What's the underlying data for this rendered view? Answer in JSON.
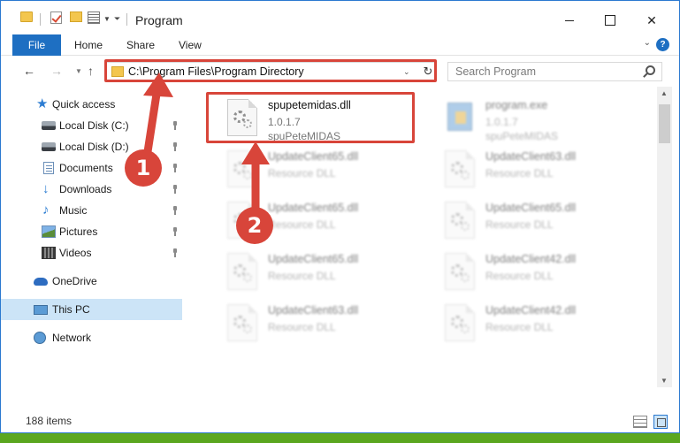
{
  "window": {
    "title": "Program"
  },
  "ribbon": {
    "tabs": [
      "File",
      "Home",
      "Share",
      "View"
    ],
    "help": "?"
  },
  "nav": {
    "address": "C:\\Program Files\\Program Directory",
    "search_placeholder": "Search Program"
  },
  "sidebar": {
    "items": [
      {
        "label": "Quick access",
        "icon": "star-icon"
      },
      {
        "label": "Local Disk (C:)",
        "icon": "drive-icon"
      },
      {
        "label": "Local Disk (D:)",
        "icon": "drive-icon"
      },
      {
        "label": "Documents",
        "icon": "documents-icon"
      },
      {
        "label": "Downloads",
        "icon": "download-icon"
      },
      {
        "label": "Music",
        "icon": "music-icon"
      },
      {
        "label": "Pictures",
        "icon": "pictures-icon"
      },
      {
        "label": "Videos",
        "icon": "videos-icon"
      },
      {
        "label": "OneDrive",
        "icon": "cloud-icon"
      },
      {
        "label": "This PC",
        "icon": "pc-icon"
      },
      {
        "label": "Network",
        "icon": "network-icon"
      }
    ]
  },
  "files": [
    {
      "name": "spupetemidas.dll",
      "version": "1.0.1.7",
      "company": "spuPeteMIDAS"
    },
    {
      "name": "program.exe",
      "version": "1.0.1.7",
      "company": "spuPeteMIDAS"
    },
    {
      "name": "UpdateClient65.dll",
      "type": "Resource DLL"
    },
    {
      "name": "UpdateClient63.dll",
      "type": "Resource DLL"
    },
    {
      "name": "UpdateClient65.dll",
      "type": "Resource DLL"
    },
    {
      "name": "UpdateClient65.dll",
      "type": "Resource DLL"
    },
    {
      "name": "UpdateClient65.dll",
      "type": "Resource DLL"
    },
    {
      "name": "UpdateClient42.dll",
      "type": "Resource DLL"
    },
    {
      "name": "UpdateClient63.dll",
      "type": "Resource DLL"
    },
    {
      "name": "UpdateClient42.dll",
      "type": "Resource DLL"
    }
  ],
  "status": {
    "item_count": "188 items"
  },
  "annotations": {
    "step1": "1",
    "step2": "2"
  },
  "colors": {
    "accent": "#1e6fc2",
    "highlight": "#d8453a",
    "selected": "#cce4f7"
  }
}
